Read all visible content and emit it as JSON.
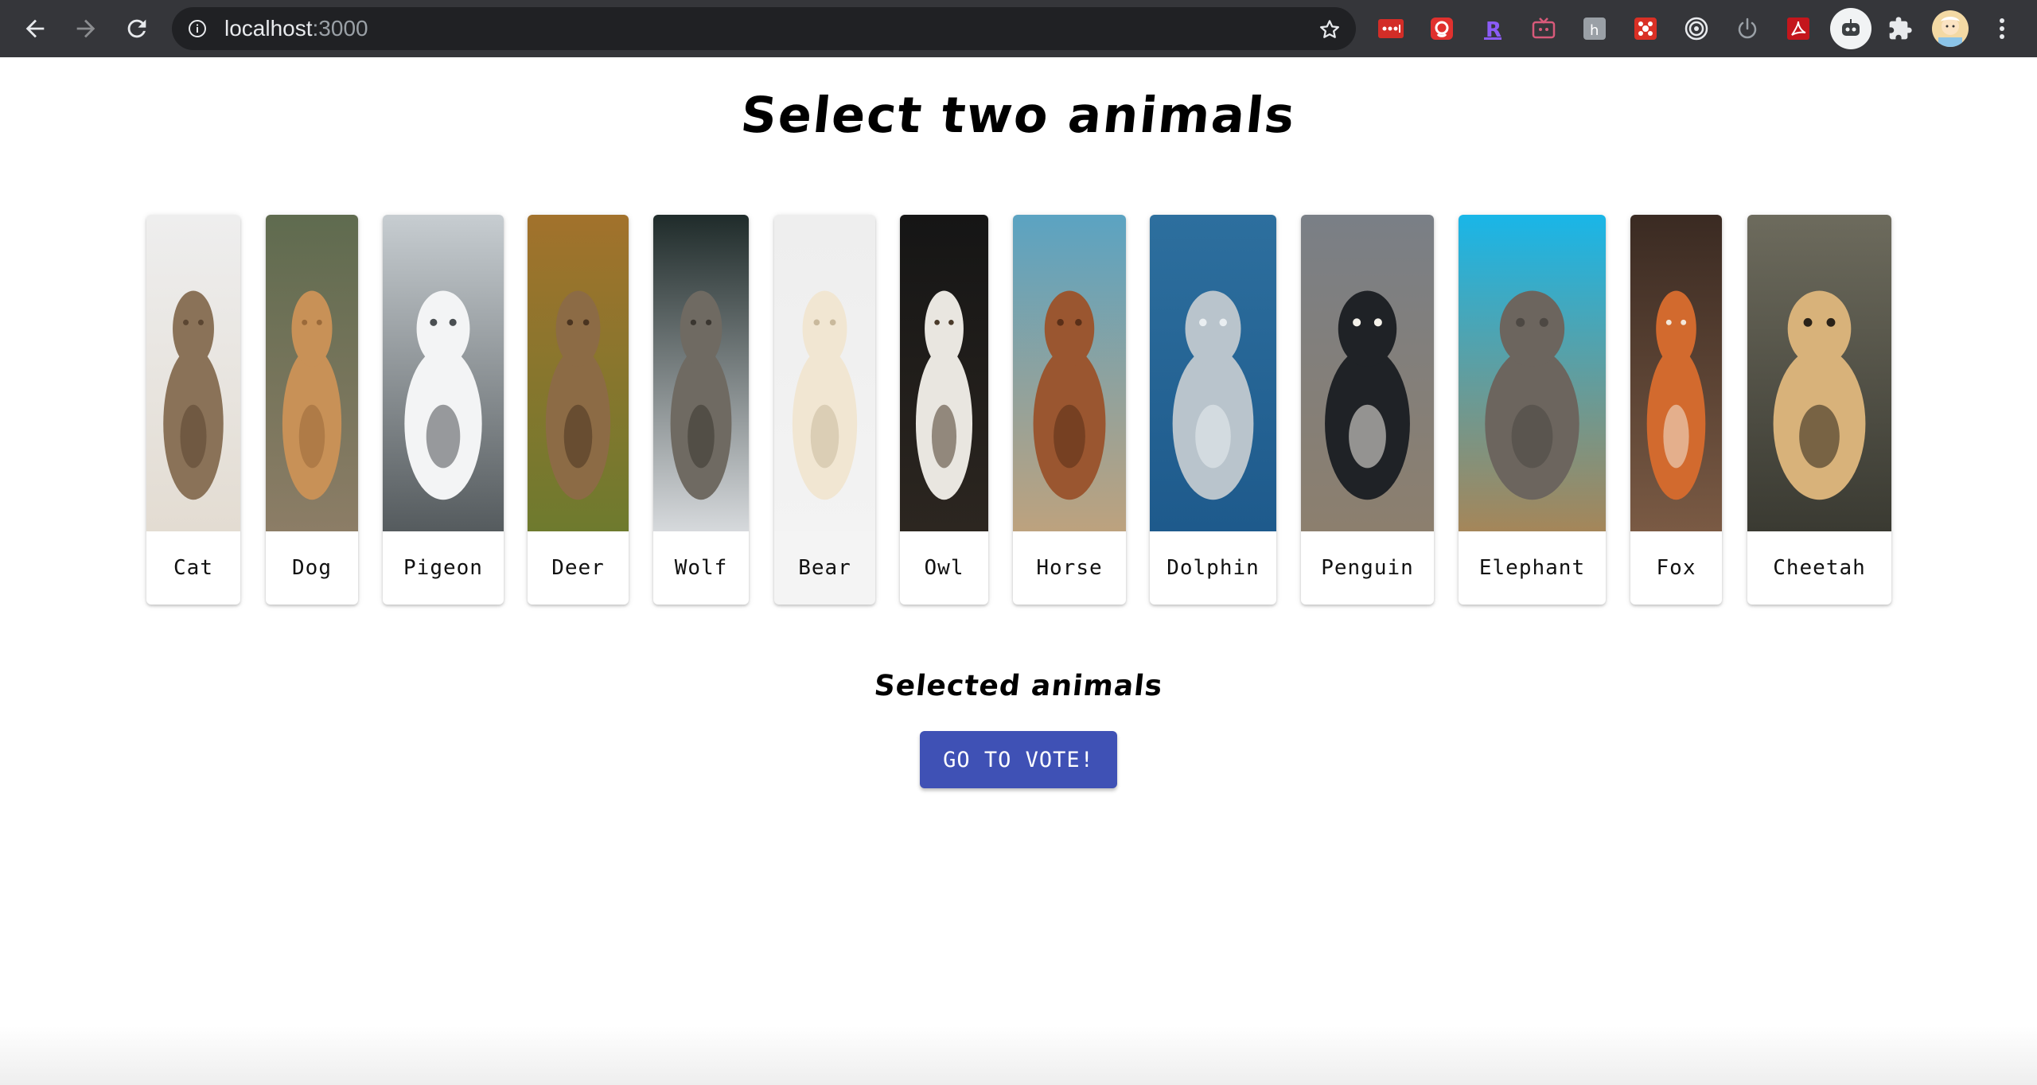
{
  "browser": {
    "url_host": "localhost",
    "url_port": ":3000"
  },
  "page": {
    "title": "Select two animals",
    "selected_heading": "Selected animals",
    "vote_button_label": "GO TO VOTE!"
  },
  "animals": [
    {
      "name": "Cat",
      "sky": "#eeeeee",
      "ground": "#e3dcd2",
      "body": "#8a7258",
      "accent": "#5b4632"
    },
    {
      "name": "Dog",
      "sky": "#5f6b4f",
      "ground": "#8c7d66",
      "body": "#c89157",
      "accent": "#9b6a3a"
    },
    {
      "name": "Pigeon",
      "sky": "#c7cdd1",
      "ground": "#555b5e",
      "body": "#f3f4f5",
      "accent": "#4a4f52"
    },
    {
      "name": "Deer",
      "sky": "#a2722c",
      "ground": "#6e7a2e",
      "body": "#8c6b45",
      "accent": "#4a3420"
    },
    {
      "name": "Wolf",
      "sky": "#1f2b2a",
      "ground": "#d6d9dc",
      "body": "#6f6a62",
      "accent": "#3a3630"
    },
    {
      "name": "Bear",
      "sky": "#eeeeee",
      "ground": "#f3f3f3",
      "body": "#f1e6d2",
      "accent": "#c9b99c"
    },
    {
      "name": "Owl",
      "sky": "#151515",
      "ground": "#2c2620",
      "body": "#e9e6e0",
      "accent": "#4a3a2a"
    },
    {
      "name": "Horse",
      "sky": "#5ba3c2",
      "ground": "#bda27e",
      "body": "#9a5630",
      "accent": "#5a2f18"
    },
    {
      "name": "Dolphin",
      "sky": "#2d6f9e",
      "ground": "#1e5a8c",
      "body": "#b9c4cc",
      "accent": "#e9eef1"
    },
    {
      "name": "Penguin",
      "sky": "#7a7f86",
      "ground": "#8c7f6e",
      "body": "#1f2226",
      "accent": "#f4f1ea"
    },
    {
      "name": "Elephant",
      "sky": "#19b6e8",
      "ground": "#a58659",
      "body": "#6c655e",
      "accent": "#4d4843"
    },
    {
      "name": "Fox",
      "sky": "#3a2a22",
      "ground": "#7a5a44",
      "body": "#d26a2e",
      "accent": "#f3e7da"
    },
    {
      "name": "Cheetah",
      "sky": "#6d6b5d",
      "ground": "#3a3a32",
      "body": "#d8b27a",
      "accent": "#2a2218"
    }
  ]
}
